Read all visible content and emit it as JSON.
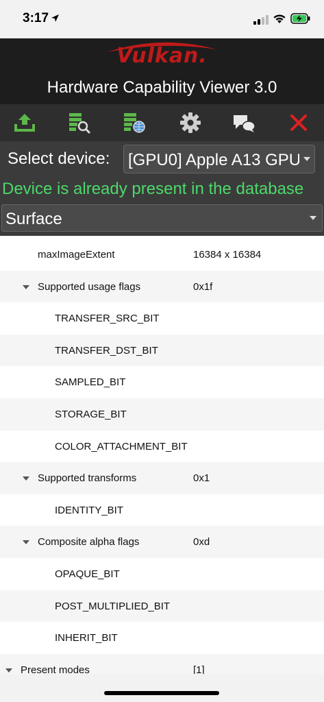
{
  "status_bar": {
    "time": "3:17"
  },
  "header": {
    "logo_text": "Vulkan.",
    "title": "Hardware Capability Viewer 3.0"
  },
  "toolbar": {
    "icons": [
      "upload-icon",
      "search-database-icon",
      "online-database-icon",
      "settings-gear-icon",
      "feedback-chat-icon",
      "close-icon"
    ],
    "upload_color": "#5cb84a",
    "close_color": "#e02020"
  },
  "device": {
    "label": "Select device:",
    "selected": "[GPU0] Apple A13 GPU"
  },
  "status_message": "Device is already present in the database",
  "status_color": "#4cd96a",
  "category": {
    "selected": "Surface"
  },
  "tree": [
    {
      "name": "maxImageExtent",
      "value": "16384 x 16384",
      "level": 1,
      "expandable": false
    },
    {
      "name": "Supported usage flags",
      "value": "0x1f",
      "level": 1,
      "expandable": true
    },
    {
      "name": "TRANSFER_SRC_BIT",
      "value": "",
      "level": 2,
      "expandable": false
    },
    {
      "name": "TRANSFER_DST_BIT",
      "value": "",
      "level": 2,
      "expandable": false
    },
    {
      "name": "SAMPLED_BIT",
      "value": "",
      "level": 2,
      "expandable": false
    },
    {
      "name": "STORAGE_BIT",
      "value": "",
      "level": 2,
      "expandable": false
    },
    {
      "name": "COLOR_ATTACHMENT_BIT",
      "value": "",
      "level": 2,
      "expandable": false
    },
    {
      "name": "Supported transforms",
      "value": "0x1",
      "level": 1,
      "expandable": true
    },
    {
      "name": "IDENTITY_BIT",
      "value": "",
      "level": 2,
      "expandable": false
    },
    {
      "name": "Composite alpha flags",
      "value": "0xd",
      "level": 1,
      "expandable": true
    },
    {
      "name": "OPAQUE_BIT",
      "value": "",
      "level": 2,
      "expandable": false
    },
    {
      "name": "POST_MULTIPLIED_BIT",
      "value": "",
      "level": 2,
      "expandable": false
    },
    {
      "name": "INHERIT_BIT",
      "value": "",
      "level": 2,
      "expandable": false
    },
    {
      "name": "Present modes",
      "value": "[1]",
      "level": 0,
      "expandable": true
    }
  ]
}
